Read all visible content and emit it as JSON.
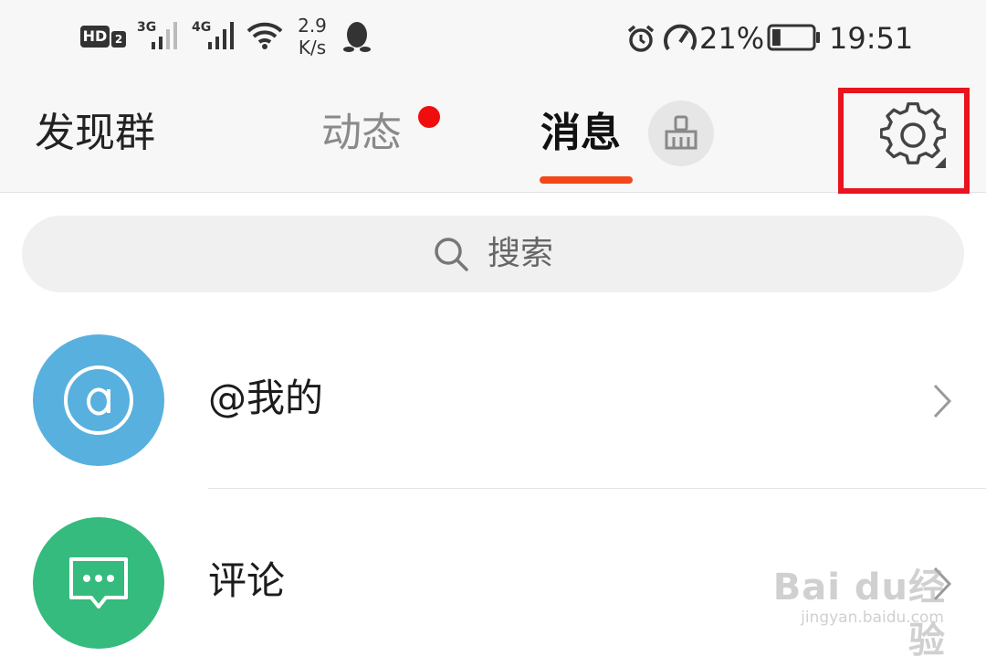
{
  "status_bar": {
    "hd": "HD",
    "hd_sub": "2",
    "net1": "3G",
    "net2": "4G",
    "speed_value": "2.9",
    "speed_unit": "K/s",
    "battery_percent": "21%",
    "time": "19:51",
    "icons": [
      "hd-icon",
      "signal-3g-icon",
      "signal-4g-icon",
      "wifi-icon",
      "qq-penguin-icon",
      "alarm-icon",
      "speedometer-icon",
      "battery-icon"
    ],
    "battery_level": 0.21
  },
  "header": {
    "tab_discover": "发现群",
    "tab_moments": "动态",
    "tab_messages": "消息",
    "accent_color": "#f2481c",
    "badge_color": "#f00d0d",
    "highlight_color": "#e8141e"
  },
  "search": {
    "placeholder": "搜索"
  },
  "list": {
    "items": [
      {
        "label": "@我的",
        "icon": "at-icon",
        "color": "#58b0de"
      },
      {
        "label": "评论",
        "icon": "comment-icon",
        "color": "#35bb7d"
      }
    ]
  },
  "watermark": {
    "logo": "Bai du经验",
    "url": "jingyan.baidu.com"
  }
}
